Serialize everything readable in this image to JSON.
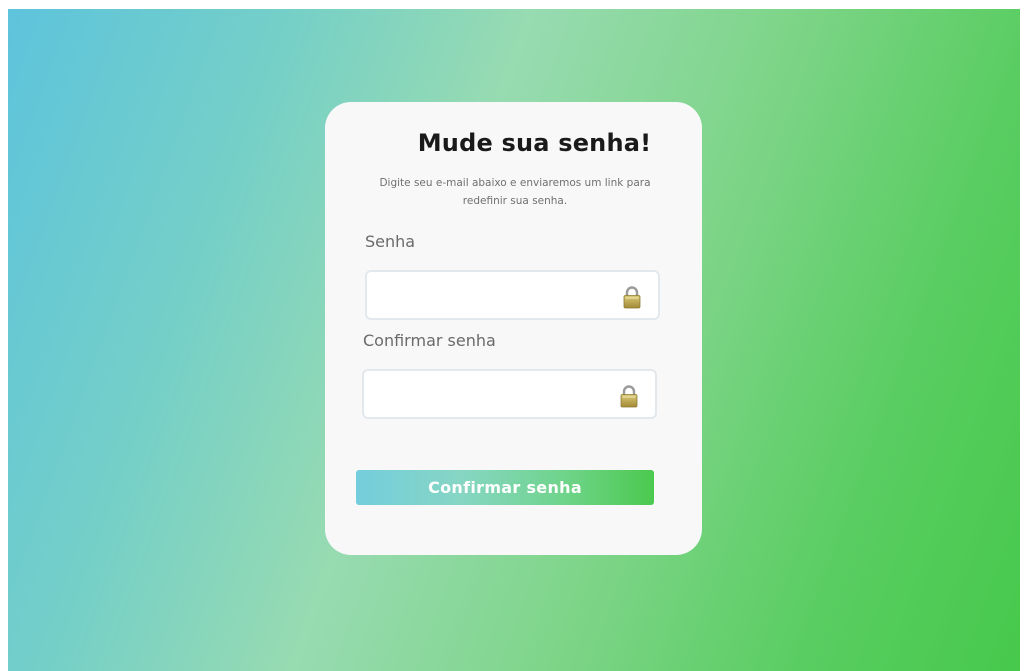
{
  "card": {
    "title": "Mude sua senha!",
    "subtitle": "Digite seu e-mail abaixo e enviaremos um link para redefinir sua senha."
  },
  "fields": [
    {
      "label": "Senha",
      "value": "",
      "placeholder": "",
      "icon": "lock-icon"
    },
    {
      "label": "Confirmar senha",
      "value": "",
      "placeholder": "",
      "icon": "lock-icon"
    }
  ],
  "submit": {
    "label": "Confirmar senha"
  },
  "colors": {
    "gradient_start": "#5ec4dc",
    "gradient_end": "#46c94c",
    "card_background": "#f8f8f8",
    "button_start": "#74cddc",
    "button_end": "#4cc94f"
  }
}
